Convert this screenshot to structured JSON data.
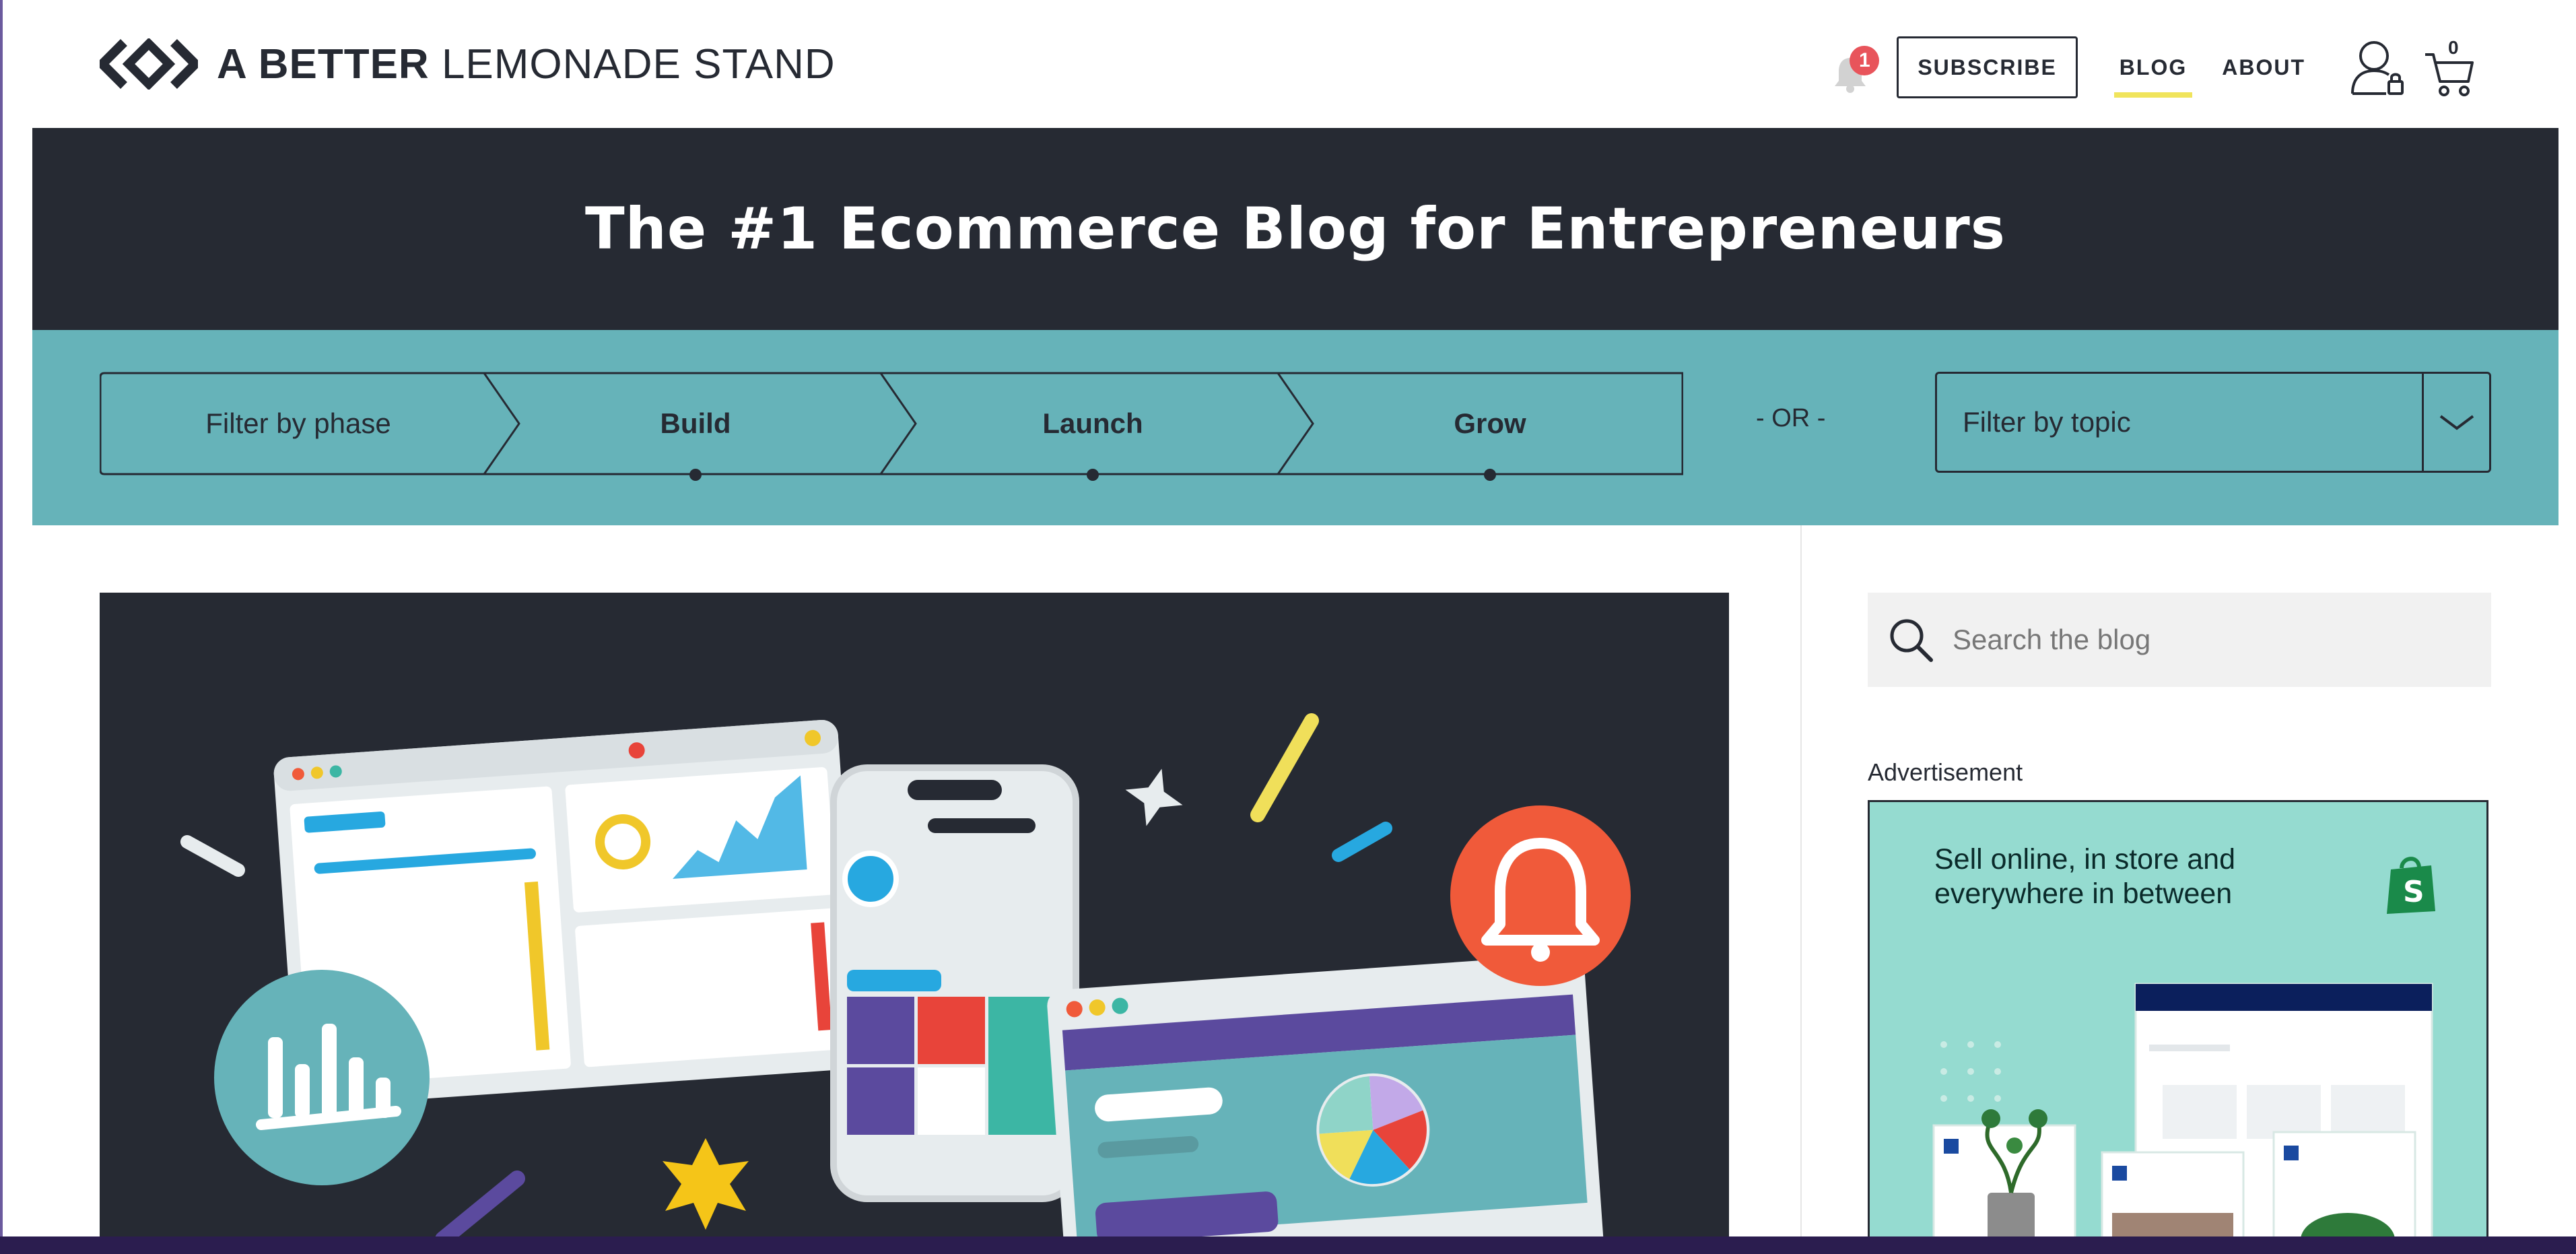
{
  "header": {
    "logo_bold": "A BETTER",
    "logo_light": "LEMONADE STAND",
    "notification_count": "1",
    "subscribe_label": "SUBSCRIBE",
    "nav": [
      {
        "label": "BLOG",
        "active": true
      },
      {
        "label": "ABOUT",
        "active": false
      }
    ],
    "cart_count": "0"
  },
  "hero": {
    "title": "The #1 Ecommerce Blog for Entrepreneurs"
  },
  "filters": {
    "phase_label": "Filter by phase",
    "phases": [
      "Build",
      "Launch",
      "Grow"
    ],
    "or_text": "- OR -",
    "topic_label": "Filter by topic"
  },
  "sidebar": {
    "search_placeholder": "Search the blog",
    "ad_label": "Advertisement",
    "ad_text": "Sell online, in store and everywhere in between"
  },
  "colors": {
    "navy": "#262a33",
    "teal": "#66b3b9",
    "accent_yellow": "#f0e45c",
    "badge_red": "#e8545b",
    "ad_mint": "#95dbd0"
  }
}
